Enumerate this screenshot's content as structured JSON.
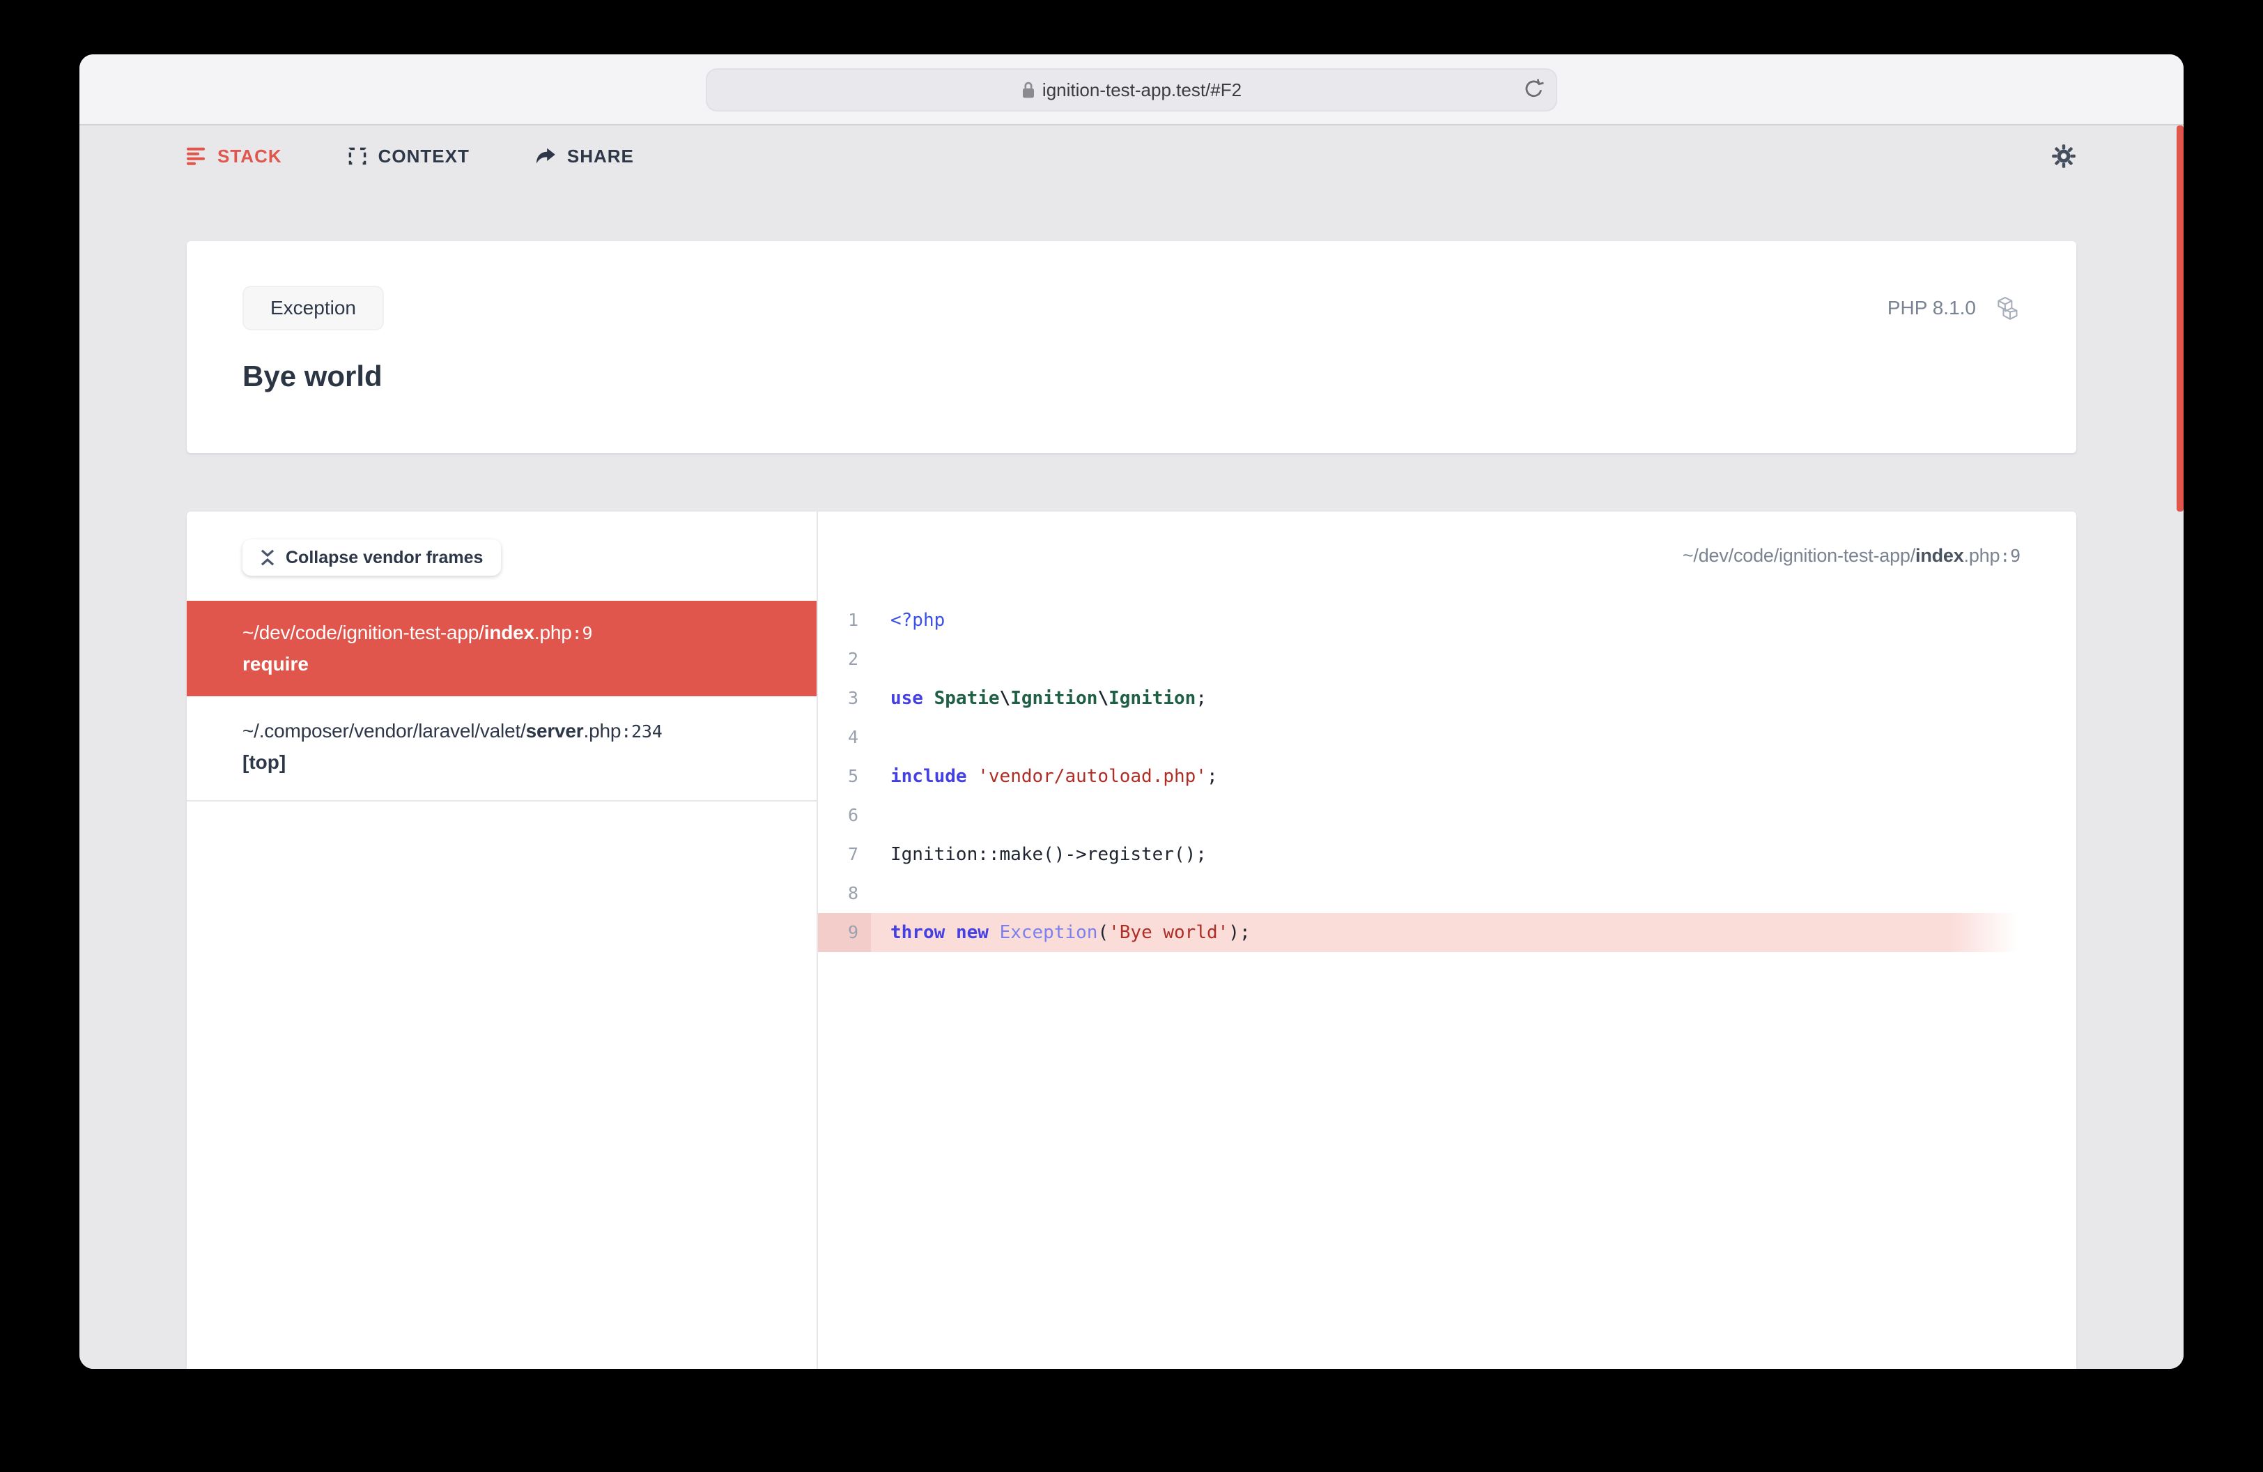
{
  "browser_chrome": {
    "url_bar": {
      "url": "ignition-test-app.test/#F2"
    }
  },
  "nav": {
    "stack_label": "STACK",
    "context_label": "CONTEXT",
    "share_label": "SHARE"
  },
  "exception_card": {
    "badge": "Exception",
    "message": "Bye world",
    "php_version": "PHP 8.1.0"
  },
  "stack_panel": {
    "collapse_button_label": "Collapse vendor frames",
    "frames": [
      {
        "prefix": "~/dev/code/ignition-test-app/",
        "file": "index",
        "ext": ".php",
        "line": "9",
        "method": "require",
        "active": true
      },
      {
        "prefix": "~/.composer/vendor/laravel/valet/",
        "file": "server",
        "ext": ".php",
        "line": "234",
        "method": "[top]",
        "active": false
      }
    ]
  },
  "code_panel": {
    "header": {
      "prefix": "~/dev/code/ignition-test-app/",
      "file": "index",
      "ext": ".php",
      "line": "9"
    },
    "highlight_line": 9,
    "lines": [
      {
        "no": 1,
        "tokens": [
          [
            "<?php",
            "tag"
          ]
        ]
      },
      {
        "no": 2,
        "tokens": []
      },
      {
        "no": 3,
        "tokens": [
          [
            "use",
            "kw"
          ],
          [
            " ",
            "pl"
          ],
          [
            "Spatie",
            "cls"
          ],
          [
            "\\",
            "op"
          ],
          [
            "Ignition",
            "cls"
          ],
          [
            "\\",
            "op"
          ],
          [
            "Ignition",
            "cls"
          ],
          [
            ";",
            "pl"
          ]
        ]
      },
      {
        "no": 4,
        "tokens": []
      },
      {
        "no": 5,
        "tokens": [
          [
            "include",
            "kw"
          ],
          [
            " ",
            "pl"
          ],
          [
            "'vendor/autoload.php'",
            "str"
          ],
          [
            ";",
            "pl"
          ]
        ]
      },
      {
        "no": 6,
        "tokens": []
      },
      {
        "no": 7,
        "tokens": [
          [
            "Ignition::make()->register();",
            "pl"
          ]
        ]
      },
      {
        "no": 8,
        "tokens": []
      },
      {
        "no": 9,
        "tokens": [
          [
            "throw",
            "kw"
          ],
          [
            " ",
            "pl"
          ],
          [
            "new",
            "kw"
          ],
          [
            " ",
            "pl"
          ],
          [
            "Exception",
            "exc"
          ],
          [
            "(",
            "pl"
          ],
          [
            "'Bye world'",
            "str"
          ],
          [
            ")",
            "pl"
          ],
          [
            ";",
            "pl"
          ]
        ]
      }
    ]
  },
  "colors": {
    "accent_red": "#e0564c",
    "highlight_row": "#fadcd9",
    "highlight_gutter": "#f3cdc9",
    "keyword": "#4540e2",
    "php_tag": "#3b50e4",
    "class_green": "#1f5f45",
    "string_red": "#ae2e26",
    "exception_name": "#7c80ee",
    "code_default": "#1e2430"
  }
}
